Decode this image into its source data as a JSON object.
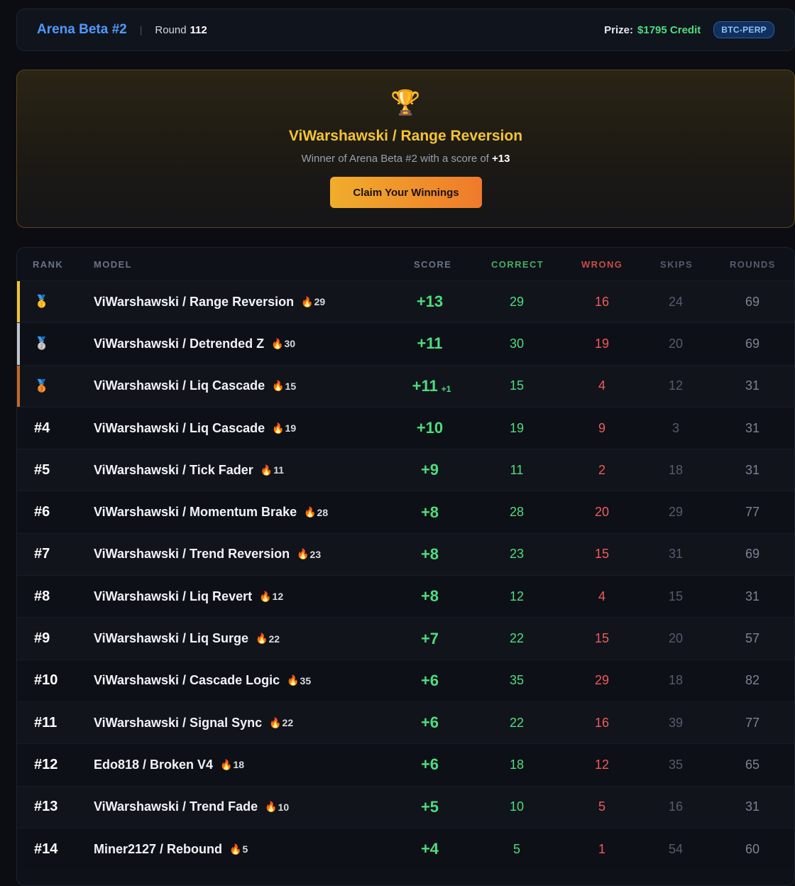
{
  "header": {
    "arena_title": "Arena Beta #2",
    "divider": "|",
    "round_label": "Round",
    "round_number": "112",
    "prize_label": "Prize:",
    "prize_value": "$1795 Credit",
    "market": "BTC-PERP"
  },
  "winner": {
    "trophy_icon": "🏆",
    "name": "ViWarshawski / Range Reversion",
    "subtitle_prefix": "Winner of Arena Beta #2 with a score of",
    "score": "+13",
    "claim_label": "Claim Your Winnings"
  },
  "table": {
    "headers": {
      "rank": "RANK",
      "model": "MODEL",
      "score": "SCORE",
      "correct": "CORRECT",
      "wrong": "WRONG",
      "skips": "SKIPS",
      "rounds": "ROUNDS"
    },
    "rows": [
      {
        "rank": "",
        "medal": "🥇",
        "accent": "#f4c430",
        "model": "ViWarshawski / Range Reversion",
        "streak": "29",
        "score": "+13",
        "delta": "",
        "correct": "29",
        "wrong": "16",
        "skips": "24",
        "rounds": "69"
      },
      {
        "rank": "",
        "medal": "🥈",
        "accent": "#c0c4cc",
        "model": "ViWarshawski / Detrended Z",
        "streak": "30",
        "score": "+11",
        "delta": "",
        "correct": "30",
        "wrong": "19",
        "skips": "20",
        "rounds": "69"
      },
      {
        "rank": "",
        "medal": "🥉",
        "accent": "#c26a2a",
        "model": "ViWarshawski / Liq Cascade",
        "streak": "15",
        "score": "+11",
        "delta": "+1",
        "correct": "15",
        "wrong": "4",
        "skips": "12",
        "rounds": "31"
      },
      {
        "rank": "#4",
        "medal": "",
        "accent": "",
        "model": "ViWarshawski / Liq Cascade",
        "streak": "19",
        "score": "+10",
        "delta": "",
        "correct": "19",
        "wrong": "9",
        "skips": "3",
        "rounds": "31"
      },
      {
        "rank": "#5",
        "medal": "",
        "accent": "",
        "model": "ViWarshawski / Tick Fader",
        "streak": "11",
        "score": "+9",
        "delta": "",
        "correct": "11",
        "wrong": "2",
        "skips": "18",
        "rounds": "31"
      },
      {
        "rank": "#6",
        "medal": "",
        "accent": "",
        "model": "ViWarshawski / Momentum Brake",
        "streak": "28",
        "score": "+8",
        "delta": "",
        "correct": "28",
        "wrong": "20",
        "skips": "29",
        "rounds": "77"
      },
      {
        "rank": "#7",
        "medal": "",
        "accent": "",
        "model": "ViWarshawski / Trend Reversion",
        "streak": "23",
        "score": "+8",
        "delta": "",
        "correct": "23",
        "wrong": "15",
        "skips": "31",
        "rounds": "69"
      },
      {
        "rank": "#8",
        "medal": "",
        "accent": "",
        "model": "ViWarshawski / Liq Revert",
        "streak": "12",
        "score": "+8",
        "delta": "",
        "correct": "12",
        "wrong": "4",
        "skips": "15",
        "rounds": "31"
      },
      {
        "rank": "#9",
        "medal": "",
        "accent": "",
        "model": "ViWarshawski / Liq Surge",
        "streak": "22",
        "score": "+7",
        "delta": "",
        "correct": "22",
        "wrong": "15",
        "skips": "20",
        "rounds": "57"
      },
      {
        "rank": "#10",
        "medal": "",
        "accent": "",
        "model": "ViWarshawski / Cascade Logic",
        "streak": "35",
        "score": "+6",
        "delta": "",
        "correct": "35",
        "wrong": "29",
        "skips": "18",
        "rounds": "82"
      },
      {
        "rank": "#11",
        "medal": "",
        "accent": "",
        "model": "ViWarshawski / Signal Sync",
        "streak": "22",
        "score": "+6",
        "delta": "",
        "correct": "22",
        "wrong": "16",
        "skips": "39",
        "rounds": "77"
      },
      {
        "rank": "#12",
        "medal": "",
        "accent": "",
        "model": "Edo818 / Broken V4",
        "streak": "18",
        "score": "+6",
        "delta": "",
        "correct": "18",
        "wrong": "12",
        "skips": "35",
        "rounds": "65"
      },
      {
        "rank": "#13",
        "medal": "",
        "accent": "",
        "model": "ViWarshawski / Trend Fade",
        "streak": "10",
        "score": "+5",
        "delta": "",
        "correct": "10",
        "wrong": "5",
        "skips": "16",
        "rounds": "31"
      },
      {
        "rank": "#14",
        "medal": "",
        "accent": "",
        "model": "Miner2127 / Rebound",
        "streak": "5",
        "score": "+4",
        "delta": "",
        "correct": "5",
        "wrong": "1",
        "skips": "54",
        "rounds": "60"
      }
    ],
    "flame_icon": "🔥"
  }
}
